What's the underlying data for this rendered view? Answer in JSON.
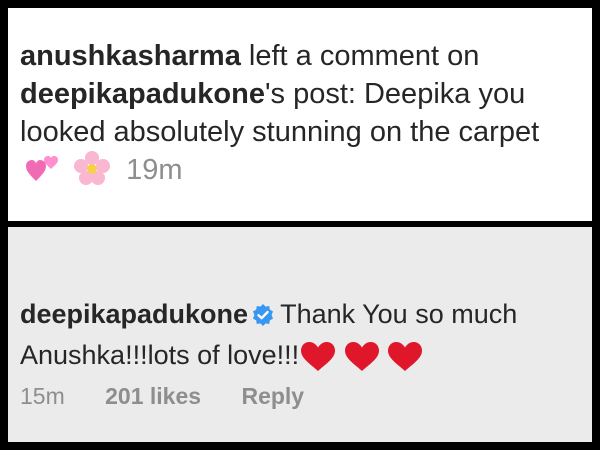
{
  "notification": {
    "actor": "anushkasharma",
    "action_text": " left a comment on ",
    "post_owner": "deepikapadukone",
    "post_suffix": "'s post: Deepika you looked absolutely stunning on the carpet",
    "emojis": [
      "two-hearts-icon",
      "cherry-blossom-icon"
    ],
    "time_ago": "19m"
  },
  "reply": {
    "username": "deepikapadukone",
    "verified_icon": "verified-badge-icon",
    "text": "Thank You so much Anushka!!!lots of love!!!",
    "hearts": [
      "red-heart-icon",
      "red-heart-icon",
      "red-heart-icon"
    ],
    "time_ago": "15m",
    "likes": "201 likes",
    "reply_label": "Reply"
  },
  "colors": {
    "text": "#262626",
    "muted": "#8e8e8e",
    "verified_blue": "#3897f0",
    "heart_red": "#e0162b",
    "reply_bg": "#ebebeb"
  }
}
